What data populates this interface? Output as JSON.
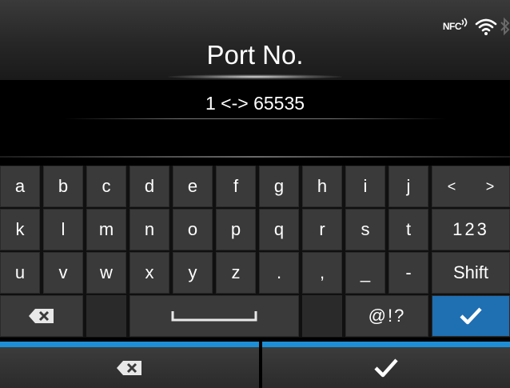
{
  "status": {
    "nfc_label": "NFC"
  },
  "header": {
    "title": "Port No."
  },
  "range": {
    "text": "1 <-> 65535"
  },
  "keyboard": {
    "row1": [
      "a",
      "b",
      "c",
      "d",
      "e",
      "f",
      "g",
      "h",
      "i",
      "j"
    ],
    "row2": [
      "k",
      "l",
      "m",
      "n",
      "o",
      "p",
      "q",
      "r",
      "s",
      "t"
    ],
    "row3": [
      "u",
      "v",
      "w",
      "x",
      "y",
      "z",
      ".",
      ",",
      "_",
      "-"
    ],
    "left_arrow": "<",
    "right_arrow": ">",
    "numbers_label": "123",
    "shift_label": "Shift",
    "symbols_label": "@!?"
  },
  "colors": {
    "accent_blue": "#1f6fb3",
    "bar_blue": "#1e8fd6"
  },
  "icons": {
    "backspace": "backspace-icon",
    "confirm": "checkmark-icon",
    "space": "space-bar-icon"
  }
}
